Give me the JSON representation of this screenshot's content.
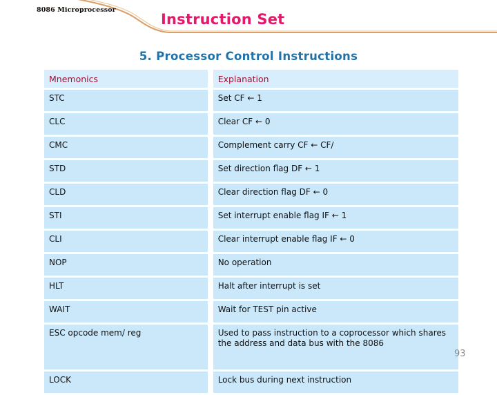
{
  "header": {
    "kicker": "8086 Microprocessor",
    "title": "Instruction Set",
    "accent_color": "#e5186c",
    "rule_color": "#d9a06a"
  },
  "section": {
    "subtitle": "5. Processor Control Instructions",
    "subtitle_color": "#2272a8"
  },
  "table": {
    "header_bg": "#d9eefc",
    "cell_bg": "#cbe8fa",
    "header_text_color": "#9e1032",
    "columns": [
      {
        "key": "mnemonics",
        "label": "Mnemonics"
      },
      {
        "key": "explanation",
        "label": "Explanation"
      }
    ],
    "rows": [
      {
        "mnemonics": "STC",
        "explanation": "Set CF ← 1"
      },
      {
        "mnemonics": "CLC",
        "explanation": "Clear CF ← 0"
      },
      {
        "mnemonics": "CMC",
        "explanation": "Complement carry CF ← CF/"
      },
      {
        "mnemonics": "STD",
        "explanation": "Set direction flag  DF ←  1"
      },
      {
        "mnemonics": "CLD",
        "explanation": "Clear direction flag  DF ←  0"
      },
      {
        "mnemonics": "STI",
        "explanation": "Set interrupt enable flag  IF ←  1"
      },
      {
        "mnemonics": "CLI",
        "explanation": "Clear interrupt enable flag  IF ←  0"
      },
      {
        "mnemonics": "NOP",
        "explanation": "No operation"
      },
      {
        "mnemonics": "HLT",
        "explanation": "Halt after interrupt is set"
      },
      {
        "mnemonics": "WAIT",
        "explanation": "Wait for TEST pin active"
      },
      {
        "mnemonics": "ESC opcode mem/ reg",
        "explanation": "Used to pass instruction to a coprocessor which shares the address and data bus with the 8086",
        "tall": true
      },
      {
        "mnemonics": "LOCK",
        "explanation": "Lock bus during next instruction"
      }
    ]
  },
  "footer": {
    "page_number": "93"
  }
}
